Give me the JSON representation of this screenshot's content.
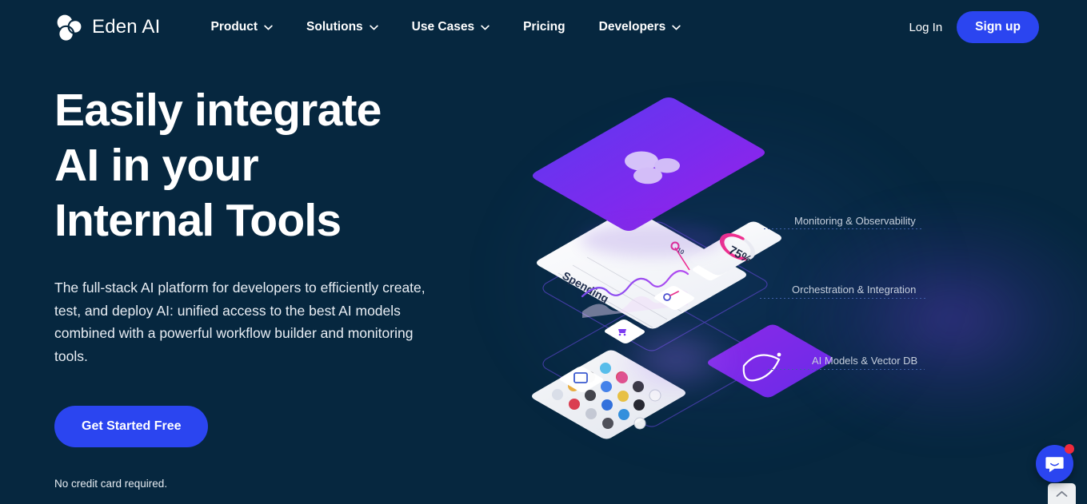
{
  "brand": {
    "name": "Eden AI",
    "logo_icon": "eden-ai-three-circles-logo"
  },
  "nav": {
    "items": [
      {
        "label": "Product",
        "has_dropdown": true,
        "icon": "chevron-down-icon"
      },
      {
        "label": "Solutions",
        "has_dropdown": true,
        "icon": "chevron-down-icon"
      },
      {
        "label": "Use Cases",
        "has_dropdown": true,
        "icon": "chevron-down-icon"
      },
      {
        "label": "Pricing",
        "has_dropdown": false,
        "icon": ""
      },
      {
        "label": "Developers",
        "has_dropdown": true,
        "icon": "chevron-down-icon"
      }
    ],
    "login_label": "Log In",
    "signup_label": "Sign up"
  },
  "hero": {
    "headline_lines": [
      "Easily integrate",
      "AI in your",
      "Internal Tools"
    ],
    "subcopy": "The full-stack AI platform for developers to efficiently create, test, and deploy AI: unified access to the best AI models combined with a powerful workflow builder and monitoring tools.",
    "cta_label": "Get Started Free",
    "note": "No credit card required."
  },
  "illustration": {
    "layer_labels": [
      "Monitoring & Observability",
      "Orchestration & Integration",
      "AI Models & Vector DB"
    ],
    "card_texts": {
      "spending": "Spending",
      "donut_value": "75%",
      "axis_value": "$510"
    }
  },
  "widgets": {
    "chat_icon": "intercom-chat-icon",
    "chat_badge": "",
    "scroll_top_icon": "chevron-up-icon"
  },
  "colors": {
    "background": "#06273f",
    "accent_blue": "#2b45f0",
    "card_purple_from": "#5a3bf0",
    "card_purple_to": "#9b1fe8",
    "donut_pink": "#ef2f8f",
    "label_text": "#c6cfdc"
  }
}
